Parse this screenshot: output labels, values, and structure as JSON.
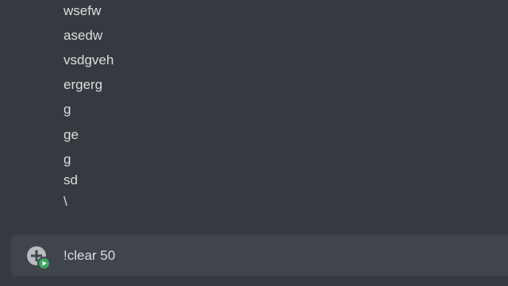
{
  "messages": [
    {
      "text": "wsefw"
    },
    {
      "text": "asedw"
    },
    {
      "text": "vsdgveh"
    },
    {
      "text": "ergerg"
    },
    {
      "text": "g"
    },
    {
      "text": "ge"
    },
    {
      "text": "g"
    },
    {
      "text": "sd"
    },
    {
      "text": "\\"
    }
  ],
  "composer": {
    "value": "!clear 50",
    "attach_icon": "plus-circle-icon",
    "status_icon": "play-badge-icon"
  },
  "colors": {
    "background": "#36393f",
    "composer_bg": "#40444b",
    "text": "#dcddde",
    "icon": "#b9bbbe",
    "badge": "#3ba55d"
  }
}
